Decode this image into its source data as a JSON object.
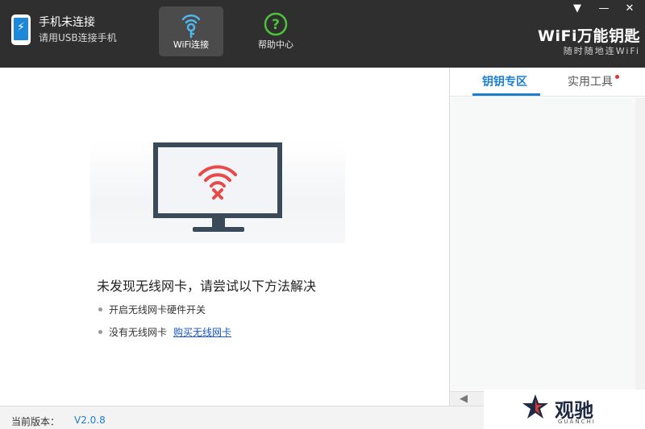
{
  "header": {
    "phone_status": "手机未连接",
    "phone_hint": "请用USB连接手机",
    "nav": [
      {
        "label": "WiFi连接",
        "icon": "wifi-key-icon",
        "active": true
      },
      {
        "label": "帮助中心",
        "icon": "help-icon",
        "active": false
      }
    ],
    "brand_name": "WiFi万能钥匙",
    "brand_slogan": "随时随地连WiFi",
    "window_controls": [
      "▼",
      "—",
      "✕"
    ]
  },
  "main": {
    "message_title": "未发现无线网卡，请尝试以下方法解决",
    "tips": [
      {
        "text": "开启无线网卡硬件开关",
        "link": ""
      },
      {
        "text": "没有无线网卡",
        "link": "购买无线网卡"
      }
    ]
  },
  "side_panel": {
    "tabs": [
      {
        "label": "钥钥专区",
        "active": true
      },
      {
        "label": "实用工具",
        "active": false,
        "badge": true
      }
    ]
  },
  "footer": {
    "version_label": "当前版本：",
    "version_value": "V2.0.8"
  },
  "watermark": {
    "text": "观驰",
    "subtext": "GUANCHI"
  },
  "colors": {
    "header_bg": "#2f2f2f",
    "accent": "#1d7fd1",
    "wifi_error": "#e84a4a",
    "help_green": "#4cc23a"
  }
}
